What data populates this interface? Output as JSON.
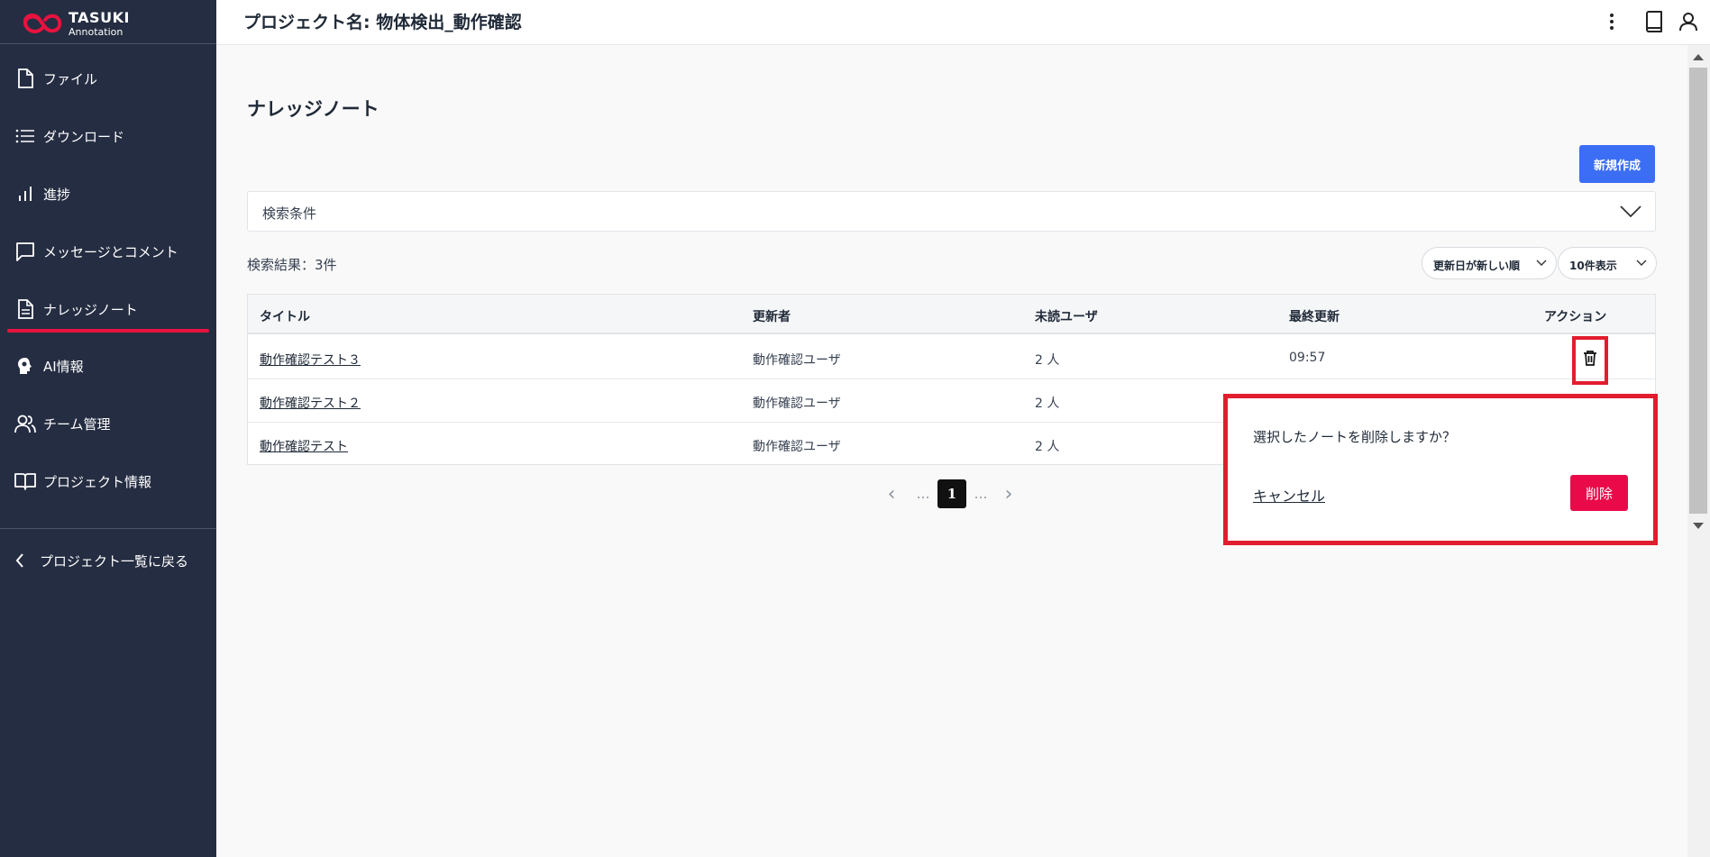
{
  "sidebar": {
    "logo": {
      "line1": "TASUKI",
      "line2": "Annotation"
    },
    "items": [
      {
        "label": "ファイル",
        "icon": "file-icon"
      },
      {
        "label": "ダウンロード",
        "icon": "list-icon"
      },
      {
        "label": "進捗",
        "icon": "bar-chart-icon"
      },
      {
        "label": "メッセージとコメント",
        "icon": "chat-icon"
      },
      {
        "label": "ナレッジノート",
        "icon": "document-icon",
        "active": true
      },
      {
        "label": "AI情報",
        "icon": "ai-head-icon"
      },
      {
        "label": "チーム管理",
        "icon": "users-icon"
      },
      {
        "label": "プロジェクト情報",
        "icon": "book-icon"
      }
    ],
    "back": {
      "label": "プロジェクト一覧に戻る",
      "icon": "chevron-left-icon"
    }
  },
  "header": {
    "title": "プロジェクト名: 物体検出_動作確認",
    "icons": [
      "more-vertical-icon",
      "book-icon",
      "user-icon"
    ]
  },
  "main": {
    "heading": "ナレッジノート",
    "new_button": "新規作成",
    "search": {
      "label": "検索条件"
    },
    "results_count": "検索結果：3件",
    "sort_select": "更新日が新しい順",
    "perpage_select": "10件表示",
    "table": {
      "columns": [
        "タイトル",
        "更新者",
        "未読ユーザ",
        "最終更新",
        "アクション"
      ],
      "rows": [
        {
          "title": "動作確認テスト３",
          "updater": "動作確認ユーザ",
          "unread": "2 人",
          "updated": "09:57"
        },
        {
          "title": "動作確認テスト２",
          "updater": "動作確認ユーザ",
          "unread": "2 人",
          "updated": ""
        },
        {
          "title": "動作確認テスト",
          "updater": "動作確認ユーザ",
          "unread": "2 人",
          "updated": ""
        }
      ]
    },
    "pagination": {
      "prev": "‹",
      "ellipsis": "…",
      "current": "1",
      "next": "›"
    }
  },
  "popup": {
    "message": "選択したノートを削除しますか？",
    "cancel": "キャンセル",
    "delete": "削除"
  },
  "colors": {
    "sidebar_bg": "#252d42",
    "accent_red": "#e8123f",
    "primary_blue": "#3b6ef5",
    "delete_red": "#ea0a4a",
    "highlight_red": "#e11d2e"
  }
}
